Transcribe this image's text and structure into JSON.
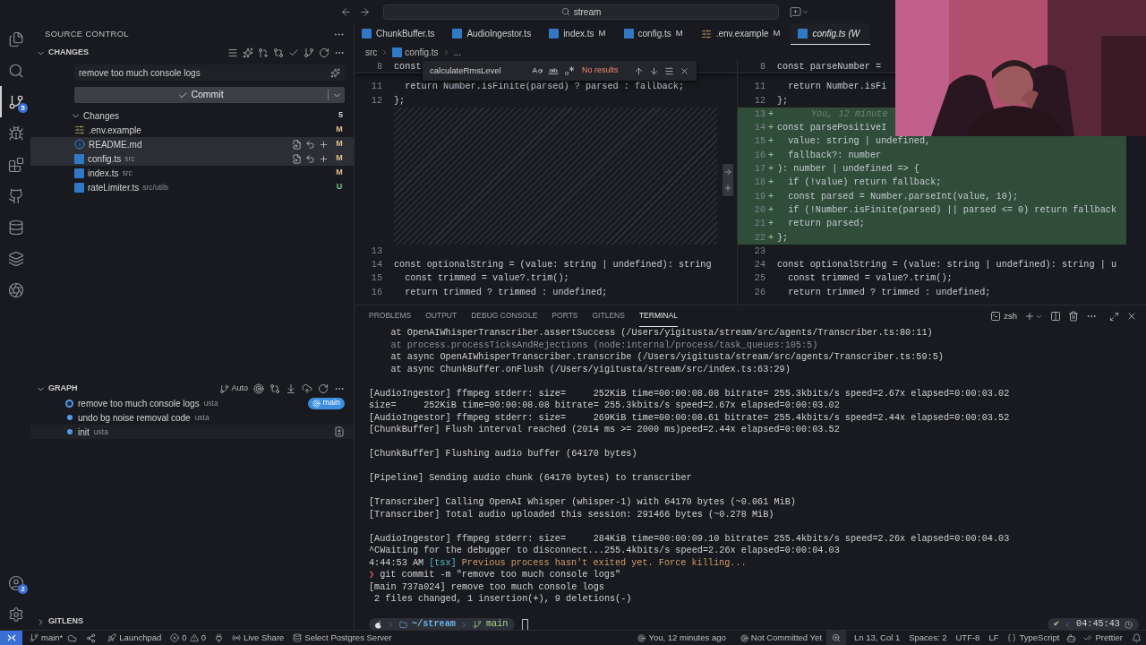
{
  "title_bar": {
    "search": "stream"
  },
  "activity_bar": {
    "items": [
      {
        "kind": "files",
        "selected": false
      },
      {
        "kind": "search",
        "selected": false
      },
      {
        "kind": "scm",
        "selected": true,
        "badge": "5"
      },
      {
        "kind": "debug",
        "selected": false
      },
      {
        "kind": "extensions",
        "selected": false
      },
      {
        "kind": "github",
        "selected": false
      },
      {
        "kind": "database",
        "selected": false
      },
      {
        "kind": "layers",
        "selected": false
      },
      {
        "kind": "ai",
        "selected": false
      }
    ],
    "bottom": [
      {
        "kind": "account",
        "badge": "2"
      },
      {
        "kind": "settings"
      }
    ]
  },
  "sidebar": {
    "title": "SOURCE CONTROL",
    "changes_header": "CHANGES",
    "message": "remove too much console logs",
    "commit_label": "Commit",
    "changes_group": {
      "label": "Changes",
      "count": "5",
      "expanded": true
    },
    "files": [
      {
        "kind": "env",
        "name": ".env.example",
        "status": "M",
        "color": "#e2c08d",
        "selected": false
      },
      {
        "kind": "info",
        "name": "README.md",
        "status": "M",
        "color": "#e2c08d",
        "selected": true
      },
      {
        "kind": "ts",
        "name": "config.ts",
        "dir": "src",
        "status": "M",
        "color": "#e2c08d",
        "selected": true
      },
      {
        "kind": "ts",
        "name": "index.ts",
        "dir": "src",
        "status": "M",
        "color": "#e2c08d",
        "selected": false
      },
      {
        "kind": "ts",
        "name": "rateLimiter.ts",
        "dir": "src/utils",
        "status": "U",
        "color": "#73c991",
        "selected": false
      }
    ],
    "graph": {
      "title": "GRAPH",
      "mode": "Auto",
      "expanded": true,
      "commits": [
        {
          "message": "remove too much console logs",
          "author": "usta",
          "head": true,
          "branch": "main",
          "hovered": false
        },
        {
          "message": "undo bg noise removal code",
          "author": "usta",
          "head": false,
          "hovered": false
        },
        {
          "message": "init",
          "author": "usta",
          "head": false,
          "hovered": true
        }
      ]
    },
    "gitlens": {
      "title": "GITLENS",
      "expanded": false
    }
  },
  "editor": {
    "tabs": [
      {
        "kind": "ts",
        "name": "ChunkBuffer.ts",
        "selected": false,
        "preview": false
      },
      {
        "kind": "ts",
        "name": "AudioIngestor.ts",
        "selected": false,
        "preview": false
      },
      {
        "kind": "ts",
        "name": "index.ts",
        "badge": "M",
        "selected": false,
        "preview": false
      },
      {
        "kind": "ts",
        "name": "config.ts",
        "badge": "M",
        "selected": false,
        "preview": false
      },
      {
        "kind": "env",
        "name": ".env.example",
        "badge": "M",
        "selected": false,
        "preview": false
      },
      {
        "kind": "ts",
        "name": "config.ts (W",
        "selected": true,
        "preview": true
      }
    ],
    "breadcrumb": [
      {
        "kind": "folder",
        "label": "src"
      },
      {
        "kind": "ts",
        "label": "config.ts"
      },
      {
        "kind": "more",
        "label": "..."
      }
    ],
    "find": {
      "query": "calculateRmsLevel",
      "result": "No results"
    },
    "left_pane": [
      {
        "kind": "sticky",
        "number": "8",
        "code": "const"
      },
      {
        "kind": "code",
        "number": "11",
        "code": "  return Number.isFinite(parsed) ? parsed : fallback;"
      },
      {
        "kind": "code",
        "number": "12",
        "code": "};"
      },
      {
        "kind": "filler"
      },
      {
        "kind": "code",
        "number": "13"
      },
      {
        "kind": "code",
        "number": "14",
        "code": "const optionalString = (value: string | undefined): string"
      },
      {
        "kind": "code",
        "number": "15",
        "code": "  const trimmed = value?.trim();"
      },
      {
        "kind": "code",
        "number": "16",
        "code": "  return trimmed ? trimmed : undefined;"
      }
    ],
    "right_pane": [
      {
        "kind": "sticky",
        "number": "8",
        "code": "const parseNumber =",
        "added": false
      },
      {
        "kind": "code",
        "number": "11",
        "code": "  return Number.isFi",
        "added": false
      },
      {
        "kind": "code",
        "number": "12",
        "code": "};",
        "added": false
      },
      {
        "kind": "code",
        "number": "13",
        "marker": "+",
        "blame": "You, 12 minute",
        "added": true
      },
      {
        "kind": "code",
        "number": "14",
        "marker": "+",
        "code": "const parsePositiveI",
        "added": true
      },
      {
        "kind": "code",
        "number": "15",
        "marker": "+",
        "code": "  value: string | undefined,",
        "added": true
      },
      {
        "kind": "code",
        "number": "16",
        "marker": "+",
        "code": "  fallback?: number",
        "added": true
      },
      {
        "kind": "code",
        "number": "17",
        "marker": "+",
        "code": "): number | undefined => {",
        "added": true
      },
      {
        "kind": "code",
        "number": "18",
        "marker": "+",
        "code": "  if (!value) return fallback;",
        "added": true
      },
      {
        "kind": "code",
        "number": "19",
        "marker": "+",
        "code": "  const parsed = Number.parseInt(value, 10);",
        "added": true
      },
      {
        "kind": "code",
        "number": "20",
        "marker": "+",
        "code": "  if (!Number.isFinite(parsed) || parsed <= 0) return fallback",
        "added": true
      },
      {
        "kind": "code",
        "number": "21",
        "marker": "+",
        "code": "  return parsed;",
        "added": true
      },
      {
        "kind": "code",
        "number": "22",
        "marker": "+",
        "code": "};",
        "added": true
      },
      {
        "kind": "code",
        "number": "23",
        "added": false
      },
      {
        "kind": "code",
        "number": "24",
        "code": "const optionalString = (value: string | undefined): string | u",
        "added": false
      },
      {
        "kind": "code",
        "number": "25",
        "code": "  const trimmed = value?.trim();",
        "added": false
      },
      {
        "kind": "code",
        "number": "26",
        "code": "  return trimmed ? trimmed : undefined;",
        "added": false
      }
    ]
  },
  "panel": {
    "tabs": [
      {
        "label": "PROBLEMS",
        "selected": false
      },
      {
        "label": "OUTPUT",
        "selected": false
      },
      {
        "label": "DEBUG CONSOLE",
        "selected": false
      },
      {
        "label": "PORTS",
        "selected": false
      },
      {
        "label": "GITLENS",
        "selected": false
      },
      {
        "label": "TERMINAL",
        "selected": true
      }
    ],
    "shell": "zsh",
    "blocks": [
      [
        {
          "kind": "out",
          "text": "    at OpenAIWhisperTranscriber.assertSuccess (/Users/yigitusta/stream/src/agents/Transcriber.ts:80:11)"
        },
        {
          "kind": "dim",
          "text": "    at process.processTicksAndRejections (node:internal/process/task_queues:105:5)"
        },
        {
          "kind": "out",
          "text": "    at async OpenAIWhisperTranscriber.transcribe (/Users/yigitusta/stream/src/agents/Transcriber.ts:59:5)"
        },
        {
          "kind": "out",
          "text": "    at async ChunkBuffer.onFlush (/Users/yigitusta/stream/src/index.ts:63:29)"
        }
      ],
      [
        {
          "kind": "out",
          "text": "[AudioIngestor] ffmpeg stderr: size=     252KiB time=00:00:08.08 bitrate= 255.3kbits/s speed=2.67x elapsed=0:00:03.02"
        },
        {
          "kind": "out",
          "text": "size=     252KiB time=00:00:08.08 bitrate= 255.3kbits/s speed=2.67x elapsed=0:00:03.02"
        },
        {
          "kind": "out",
          "text": "[AudioIngestor] ffmpeg stderr: size=     269KiB time=00:00:08.61 bitrate= 255.4kbits/s speed=2.44x elapsed=0:00:03.52"
        },
        {
          "kind": "out",
          "text": "[ChunkBuffer] Flush interval reached (2014 ms >= 2000 ms)peed=2.44x elapsed=0:00:03.52"
        }
      ],
      [
        {
          "kind": "out",
          "text": "[ChunkBuffer] Flushing audio buffer (64170 bytes)"
        }
      ],
      [
        {
          "kind": "out",
          "text": "[Pipeline] Sending audio chunk (64170 bytes) to transcriber"
        }
      ],
      [
        {
          "kind": "out",
          "text": "[Transcriber] Calling OpenAI Whisper (whisper-1) with 64170 bytes (~0.061 MiB)"
        },
        {
          "kind": "out",
          "text": "[Transcriber] Total audio uploaded this session: 291466 bytes (~0.278 MiB)"
        }
      ],
      [
        {
          "kind": "out",
          "text": "[AudioIngestor] ffmpeg stderr: size=     284KiB time=00:00:09.10 bitrate= 255.4kbits/s speed=2.26x elapsed=0:00:04.03"
        },
        {
          "kind": "out",
          "text": "^CWaiting for the debugger to disconnect...255.4kbits/s speed=2.26x elapsed=0:00:04.03"
        },
        {
          "kind": "tsx",
          "time": "4:44:53 AM",
          "tag": "[tsx]",
          "text": "Previous process hasn't exited yet. Force killing..."
        },
        {
          "kind": "prompt",
          "symbol": "❯",
          "text": "git commit -m \"remove too much console logs\""
        },
        {
          "kind": "out",
          "text": "[main 737a024] remove too much console logs"
        },
        {
          "kind": "out",
          "text": " 2 files changed, 1 insertion(+), 9 deletions(-)"
        }
      ]
    ],
    "prompt": {
      "path": "~/stream",
      "branch": "main",
      "status": "✔",
      "time": "04:45:43"
    }
  },
  "status_bar": {
    "branch": "main*",
    "launchpad": "Launchpad",
    "errors": "0",
    "warnings": "0",
    "live_share": "Live Share",
    "postgres": "Select Postgres Server",
    "blame": "You, 12 minutes ago",
    "commit": "Not Committed Yet",
    "cursor": "Ln 13, Col 1",
    "spaces": "Spaces: 2",
    "encoding": "UTF-8",
    "eol": "LF",
    "language": "TypeScript",
    "formatter": "Prettier"
  }
}
